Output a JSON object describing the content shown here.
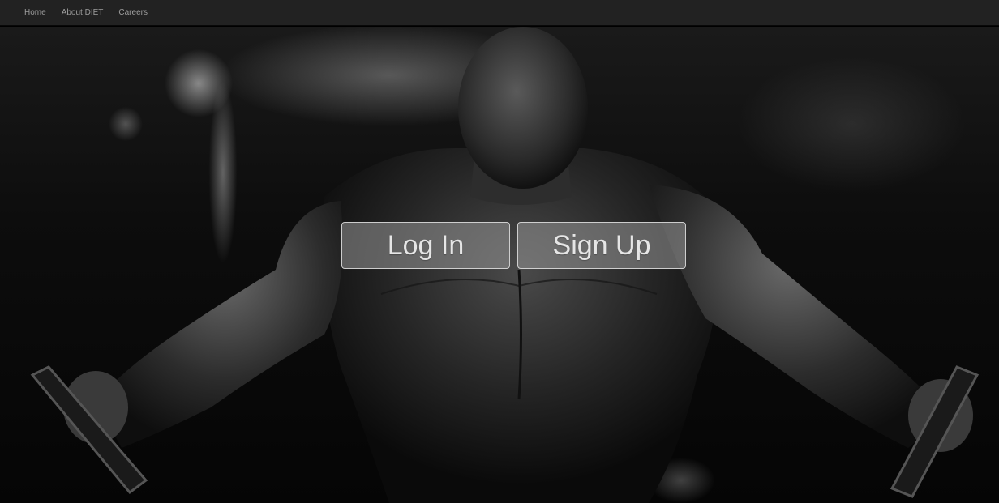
{
  "navbar": {
    "links": [
      "Home",
      "About DIET",
      "Careers"
    ]
  },
  "hero": {
    "image_description": "",
    "login_label": "Log In",
    "signup_label": "Sign Up"
  },
  "colors": {
    "navbar_bg": "#222222",
    "nav_link": "#9d9d9d",
    "button_bg": "rgba(150,150,150,0.55)",
    "button_text": "#e6e6e6"
  }
}
